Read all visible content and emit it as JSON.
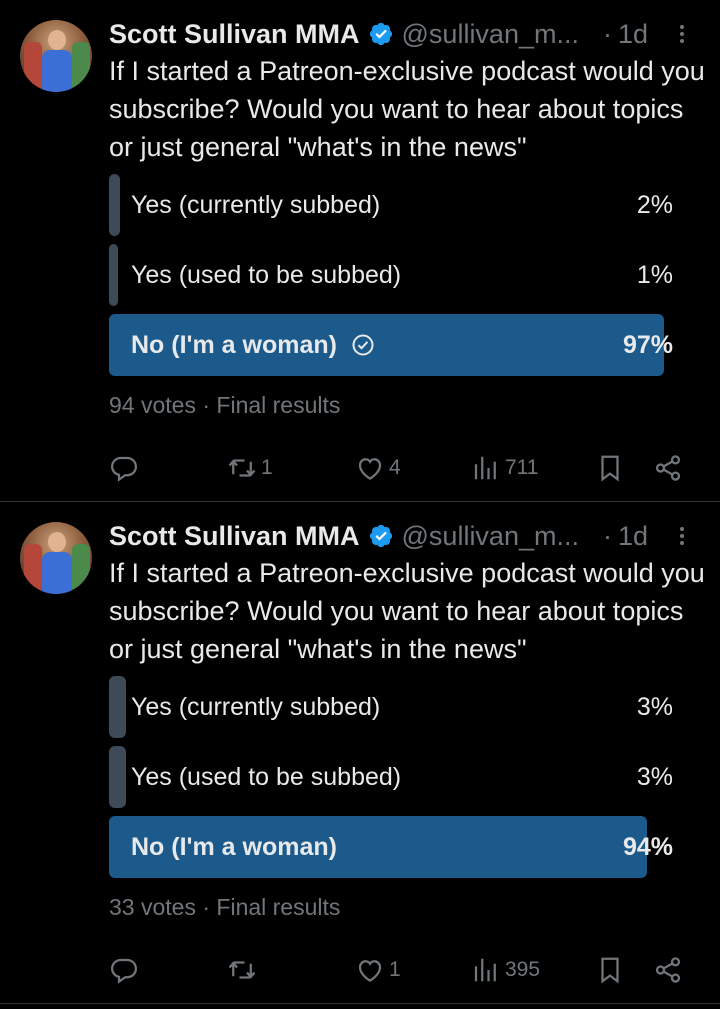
{
  "tweets": [
    {
      "author": {
        "name": "Scott Sullivan MMA",
        "handle": "@sullivan_m...",
        "dot": "·",
        "time": "1d"
      },
      "text": "If I started a Patreon-exclusive podcast would you subscribe? Would you want to hear about topics or just general \"what's in the news\"",
      "poll": {
        "options": [
          {
            "label": "Yes (currently subbed)",
            "percent_text": "2%",
            "percent": 2,
            "winner": false
          },
          {
            "label": "Yes (used to be subbed)",
            "percent_text": "1%",
            "percent": 1,
            "winner": false
          },
          {
            "label": "No (I'm a woman)",
            "percent_text": "97%",
            "percent": 97,
            "winner": true,
            "voted": true
          }
        ],
        "votes": "94 votes",
        "sep": "·",
        "status": "Final results"
      },
      "actions": {
        "replies": "",
        "reposts": "1",
        "likes": "4",
        "views": "711"
      }
    },
    {
      "author": {
        "name": "Scott Sullivan MMA",
        "handle": "@sullivan_m...",
        "dot": "·",
        "time": "1d"
      },
      "text": "If I started a Patreon-exclusive podcast would you subscribe? Would you want to hear about topics or just general \"what's in the news\"",
      "poll": {
        "options": [
          {
            "label": "Yes (currently subbed)",
            "percent_text": "3%",
            "percent": 3,
            "winner": false
          },
          {
            "label": "Yes (used to be subbed)",
            "percent_text": "3%",
            "percent": 3,
            "winner": false
          },
          {
            "label": "No (I'm a woman)",
            "percent_text": "94%",
            "percent": 94,
            "winner": true,
            "voted": false
          }
        ],
        "votes": "33 votes",
        "sep": "·",
        "status": "Final results"
      },
      "actions": {
        "replies": "",
        "reposts": "",
        "likes": "1",
        "views": "395"
      }
    }
  ],
  "colors": {
    "accent": "#1d9bf0",
    "winner_bar": "#1d5a8c",
    "loser_bar": "#3e4a57",
    "muted": "#71767b"
  },
  "icons": [
    "verified-badge-icon",
    "more-icon",
    "reply-icon",
    "repost-icon",
    "like-icon",
    "views-icon",
    "bookmark-icon",
    "share-icon",
    "voted-check-icon"
  ]
}
